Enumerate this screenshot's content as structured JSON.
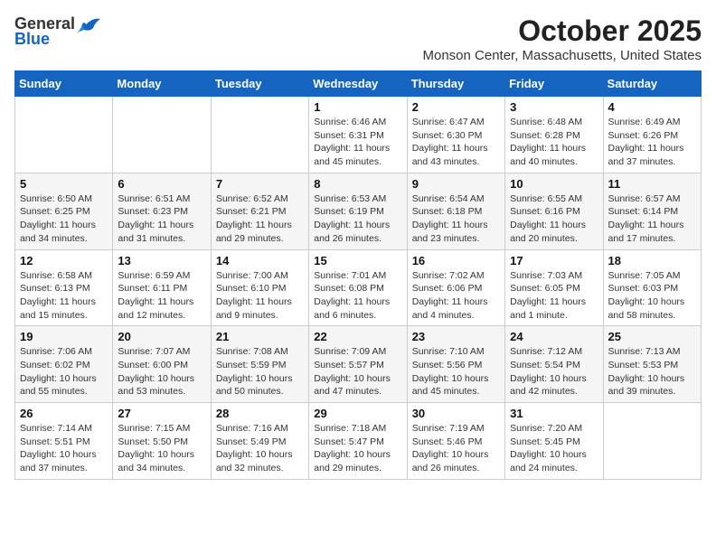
{
  "logo": {
    "general": "General",
    "blue": "Blue"
  },
  "title": "October 2025",
  "location": "Monson Center, Massachusetts, United States",
  "days_of_week": [
    "Sunday",
    "Monday",
    "Tuesday",
    "Wednesday",
    "Thursday",
    "Friday",
    "Saturday"
  ],
  "weeks": [
    [
      {
        "day": "",
        "info": ""
      },
      {
        "day": "",
        "info": ""
      },
      {
        "day": "",
        "info": ""
      },
      {
        "day": "1",
        "info": "Sunrise: 6:46 AM\nSunset: 6:31 PM\nDaylight: 11 hours and 45 minutes."
      },
      {
        "day": "2",
        "info": "Sunrise: 6:47 AM\nSunset: 6:30 PM\nDaylight: 11 hours and 43 minutes."
      },
      {
        "day": "3",
        "info": "Sunrise: 6:48 AM\nSunset: 6:28 PM\nDaylight: 11 hours and 40 minutes."
      },
      {
        "day": "4",
        "info": "Sunrise: 6:49 AM\nSunset: 6:26 PM\nDaylight: 11 hours and 37 minutes."
      }
    ],
    [
      {
        "day": "5",
        "info": "Sunrise: 6:50 AM\nSunset: 6:25 PM\nDaylight: 11 hours and 34 minutes."
      },
      {
        "day": "6",
        "info": "Sunrise: 6:51 AM\nSunset: 6:23 PM\nDaylight: 11 hours and 31 minutes."
      },
      {
        "day": "7",
        "info": "Sunrise: 6:52 AM\nSunset: 6:21 PM\nDaylight: 11 hours and 29 minutes."
      },
      {
        "day": "8",
        "info": "Sunrise: 6:53 AM\nSunset: 6:19 PM\nDaylight: 11 hours and 26 minutes."
      },
      {
        "day": "9",
        "info": "Sunrise: 6:54 AM\nSunset: 6:18 PM\nDaylight: 11 hours and 23 minutes."
      },
      {
        "day": "10",
        "info": "Sunrise: 6:55 AM\nSunset: 6:16 PM\nDaylight: 11 hours and 20 minutes."
      },
      {
        "day": "11",
        "info": "Sunrise: 6:57 AM\nSunset: 6:14 PM\nDaylight: 11 hours and 17 minutes."
      }
    ],
    [
      {
        "day": "12",
        "info": "Sunrise: 6:58 AM\nSunset: 6:13 PM\nDaylight: 11 hours and 15 minutes."
      },
      {
        "day": "13",
        "info": "Sunrise: 6:59 AM\nSunset: 6:11 PM\nDaylight: 11 hours and 12 minutes."
      },
      {
        "day": "14",
        "info": "Sunrise: 7:00 AM\nSunset: 6:10 PM\nDaylight: 11 hours and 9 minutes."
      },
      {
        "day": "15",
        "info": "Sunrise: 7:01 AM\nSunset: 6:08 PM\nDaylight: 11 hours and 6 minutes."
      },
      {
        "day": "16",
        "info": "Sunrise: 7:02 AM\nSunset: 6:06 PM\nDaylight: 11 hours and 4 minutes."
      },
      {
        "day": "17",
        "info": "Sunrise: 7:03 AM\nSunset: 6:05 PM\nDaylight: 11 hours and 1 minute."
      },
      {
        "day": "18",
        "info": "Sunrise: 7:05 AM\nSunset: 6:03 PM\nDaylight: 10 hours and 58 minutes."
      }
    ],
    [
      {
        "day": "19",
        "info": "Sunrise: 7:06 AM\nSunset: 6:02 PM\nDaylight: 10 hours and 55 minutes."
      },
      {
        "day": "20",
        "info": "Sunrise: 7:07 AM\nSunset: 6:00 PM\nDaylight: 10 hours and 53 minutes."
      },
      {
        "day": "21",
        "info": "Sunrise: 7:08 AM\nSunset: 5:59 PM\nDaylight: 10 hours and 50 minutes."
      },
      {
        "day": "22",
        "info": "Sunrise: 7:09 AM\nSunset: 5:57 PM\nDaylight: 10 hours and 47 minutes."
      },
      {
        "day": "23",
        "info": "Sunrise: 7:10 AM\nSunset: 5:56 PM\nDaylight: 10 hours and 45 minutes."
      },
      {
        "day": "24",
        "info": "Sunrise: 7:12 AM\nSunset: 5:54 PM\nDaylight: 10 hours and 42 minutes."
      },
      {
        "day": "25",
        "info": "Sunrise: 7:13 AM\nSunset: 5:53 PM\nDaylight: 10 hours and 39 minutes."
      }
    ],
    [
      {
        "day": "26",
        "info": "Sunrise: 7:14 AM\nSunset: 5:51 PM\nDaylight: 10 hours and 37 minutes."
      },
      {
        "day": "27",
        "info": "Sunrise: 7:15 AM\nSunset: 5:50 PM\nDaylight: 10 hours and 34 minutes."
      },
      {
        "day": "28",
        "info": "Sunrise: 7:16 AM\nSunset: 5:49 PM\nDaylight: 10 hours and 32 minutes."
      },
      {
        "day": "29",
        "info": "Sunrise: 7:18 AM\nSunset: 5:47 PM\nDaylight: 10 hours and 29 minutes."
      },
      {
        "day": "30",
        "info": "Sunrise: 7:19 AM\nSunset: 5:46 PM\nDaylight: 10 hours and 26 minutes."
      },
      {
        "day": "31",
        "info": "Sunrise: 7:20 AM\nSunset: 5:45 PM\nDaylight: 10 hours and 24 minutes."
      },
      {
        "day": "",
        "info": ""
      }
    ]
  ]
}
